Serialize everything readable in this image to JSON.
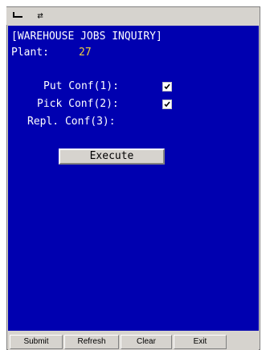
{
  "toolbar": {
    "icon_left": "keyboard-icon",
    "icon_right": "swap-icon"
  },
  "screen": {
    "title": "[WAREHOUSE JOBS INQUIRY]",
    "plant_label": "Plant:",
    "plant_value": "27",
    "put_label": "Put Conf(1):",
    "put_checked": true,
    "pick_label": "Pick Conf(2):",
    "pick_checked": true,
    "repl_label": "Repl. Conf(3):",
    "execute_label": "Execute"
  },
  "buttons": {
    "submit": "Submit",
    "refresh": "Refresh",
    "clear": "Clear",
    "exit": "Exit"
  },
  "colors": {
    "screen_bg": "#0000b0",
    "text": "#ffffff",
    "value": "#f0d040",
    "chrome": "#d6d3ce"
  }
}
